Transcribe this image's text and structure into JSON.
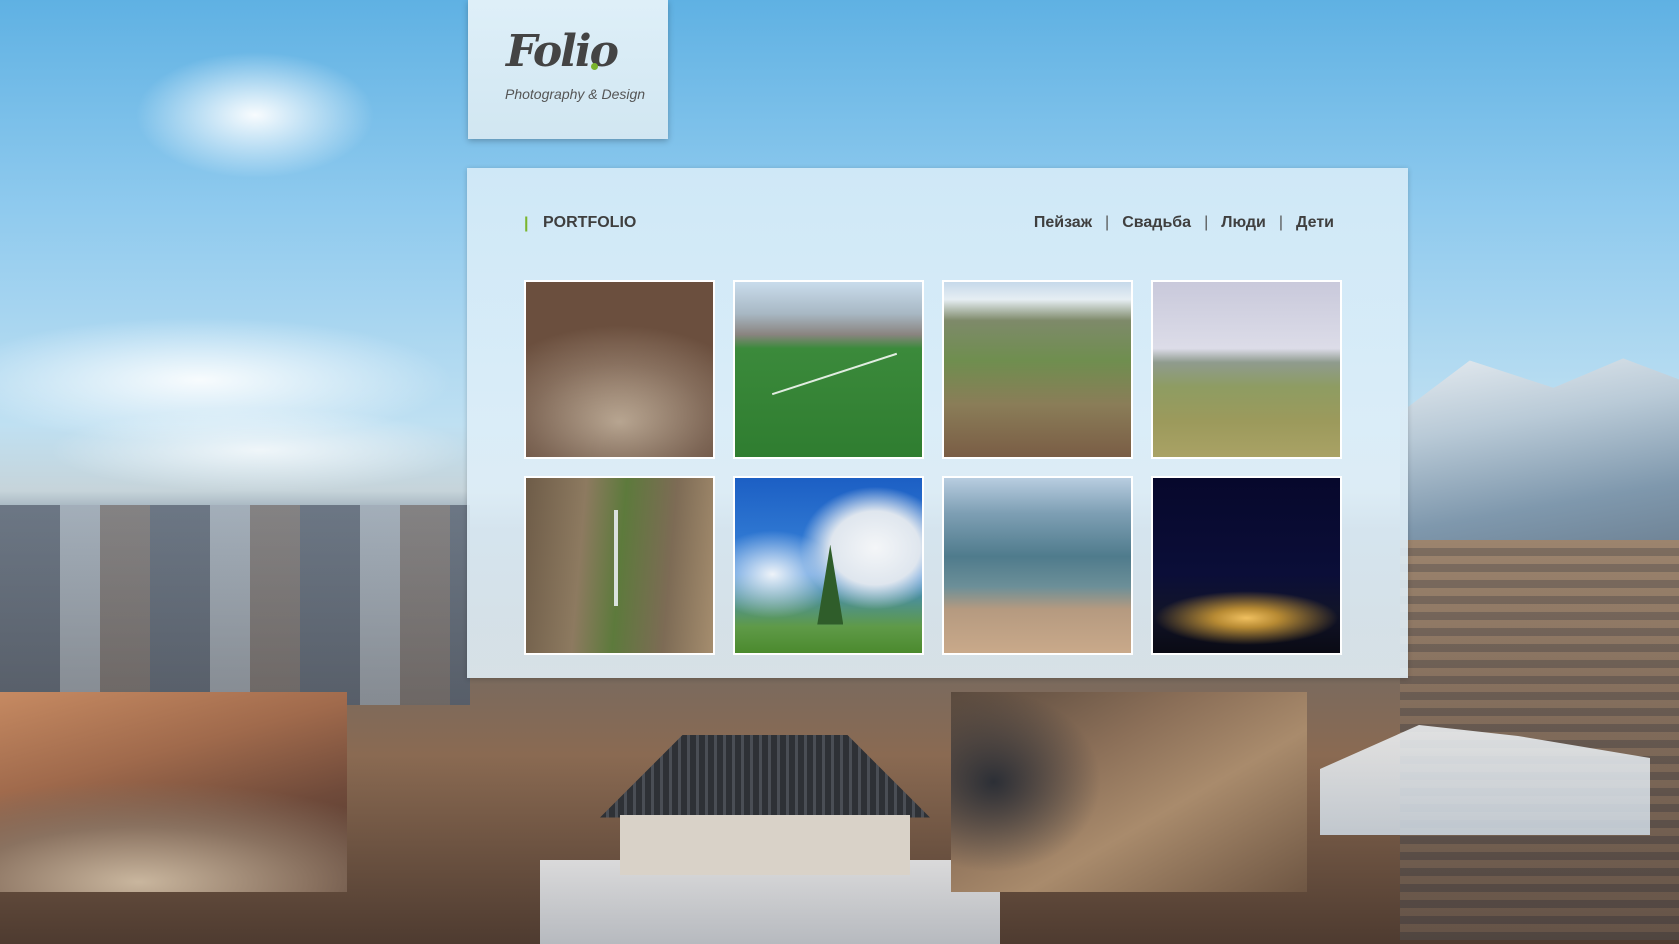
{
  "logo": {
    "name": "Folio",
    "tagline": "Photography & Design",
    "accent_color": "#7bb52e"
  },
  "portfolio": {
    "bar": "|",
    "title": "PORTFOLIO",
    "nav": {
      "separator": "|",
      "items": [
        "Пейзаж",
        "Свадьба",
        "Люди",
        "Дети"
      ]
    },
    "thumbnails": [
      {
        "subject": "mountain-village-aerial"
      },
      {
        "subject": "football-field"
      },
      {
        "subject": "green-valley"
      },
      {
        "subject": "plains-under-sky"
      },
      {
        "subject": "canyon-waterfall"
      },
      {
        "subject": "tree-blue-sky"
      },
      {
        "subject": "cliff-overlook"
      },
      {
        "subject": "city-lights-night"
      }
    ]
  },
  "background": {
    "photos": [
      "village-on-hillside",
      "man-on-rocks"
    ]
  }
}
